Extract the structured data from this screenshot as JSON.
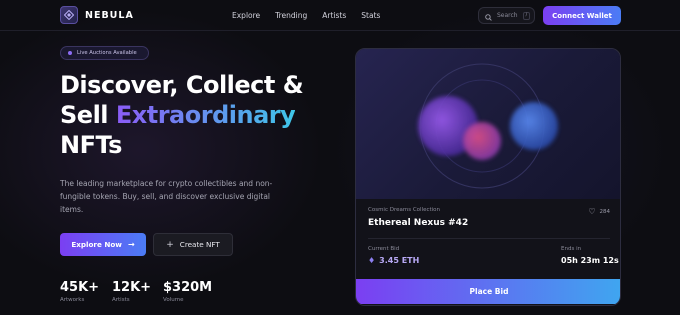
{
  "brand": {
    "name": "NEBULA"
  },
  "nav": {
    "items": [
      "Explore",
      "Trending",
      "Artists",
      "Stats"
    ]
  },
  "search": {
    "placeholder": "Search",
    "shortcut": "/"
  },
  "header": {
    "connect_label": "Connect Wallet"
  },
  "hero": {
    "badge": "Live Auctions Available",
    "title_line1": "Discover, Collect &",
    "title_line2_plain": "Sell ",
    "title_line2_accent": "Extraordinary",
    "title_line3": "NFTs",
    "description": "The leading marketplace for crypto collectibles and non-fungible tokens. Buy, sell, and discover exclusive digital items.",
    "explore_label": "Explore Now",
    "create_label": "Create NFT"
  },
  "stats": [
    {
      "value": "45K+",
      "label": "Artworks"
    },
    {
      "value": "12K+",
      "label": "Artists"
    },
    {
      "value": "$320M",
      "label": "Volume"
    }
  ],
  "card": {
    "collection": "Cosmic Dreams Collection",
    "name": "Ethereal Nexus #42",
    "likes": "284",
    "bid_label": "Current Bid",
    "bid_value": "3.45 ETH",
    "ends_label": "Ends in",
    "ends_value": "05h 23m 12s",
    "place_bid_label": "Place Bid"
  },
  "colors": {
    "background": "#0d0d12",
    "accent_purple": "#7b3ff2",
    "accent_blue": "#4b7cf5",
    "accent_cyan": "#3fc6e8"
  },
  "icons": {
    "logo": "diamond-logo-icon",
    "search": "search-icon",
    "arrow": "arrow-right-icon",
    "plus": "plus-icon",
    "heart": "heart-icon",
    "eth": "ethereum-icon"
  }
}
